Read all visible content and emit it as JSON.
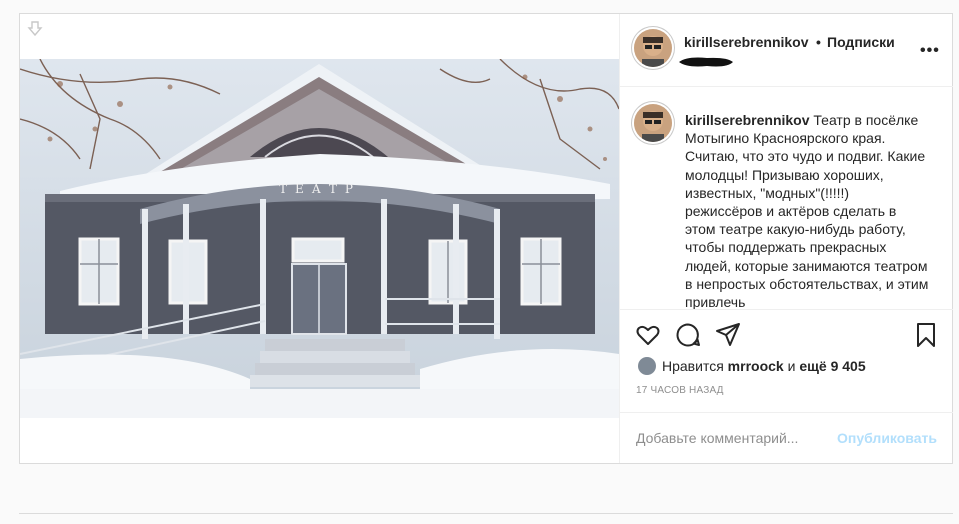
{
  "post": {
    "author": "kirillserebrennikov",
    "dot": "•",
    "follow_label": "Подписки",
    "more_label": "•••",
    "caption_text": "Театр в посёлке Мотыгино Красноярского края. Считаю, что это чудо и подвиг. Какие молодцы! Призываю хороших, известных, \"модных\"(!!!!!) режиссёров и актёров сделать в этом театре какую-нибудь работу, чтобы поддержать прекрасных людей, которые занимаются театром в непростых обстоятельствах, и этим привлечь",
    "photo_sign": "ТЕАТР",
    "likes_prefix": "Нравится",
    "likes_user": "mrroock",
    "likes_and": "и",
    "likes_rest": "ещё 9 405",
    "time_ago": "17 ЧАСОВ НАЗАД",
    "comment_placeholder": "Добавьте комментарий...",
    "publish_label": "Опубликовать"
  },
  "icons": [
    "download-icon",
    "more-icon",
    "heart-icon",
    "comment-icon",
    "share-icon",
    "bookmark-icon"
  ],
  "colors": {
    "link_disabled": "#b2dffc",
    "muted": "#8e8e8e",
    "border": "#dbdbdb"
  }
}
